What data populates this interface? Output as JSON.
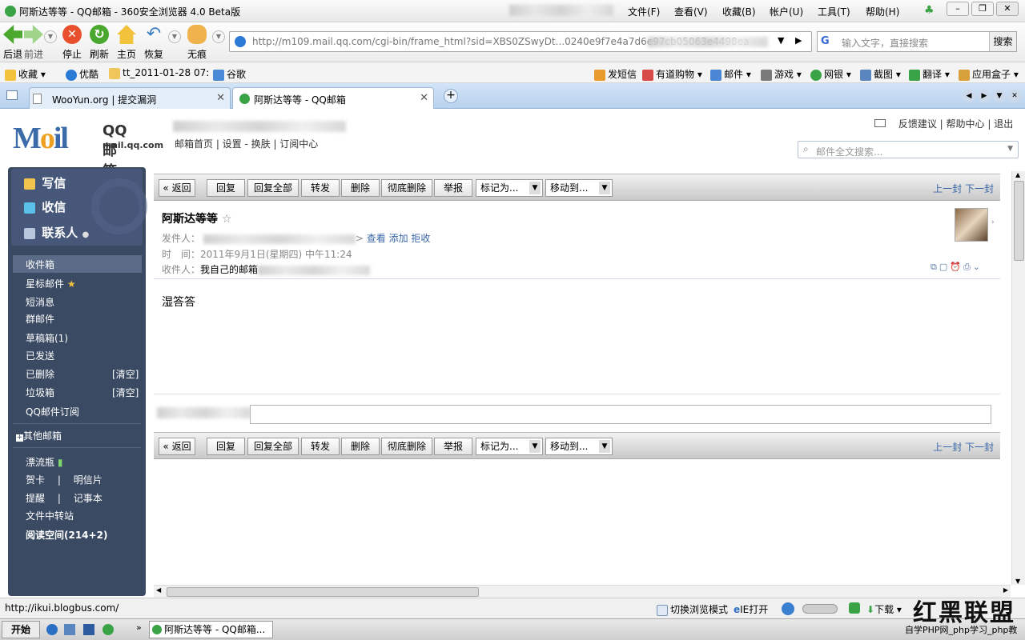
{
  "window": {
    "title": "阿斯达等等 - QQ邮箱 - 360安全浏览器 4.0 Beta版",
    "menu": [
      "文件(F)",
      "查看(V)",
      "收藏(B)",
      "帐户(U)",
      "工具(T)",
      "帮助(H)"
    ]
  },
  "nav": {
    "back": "后退",
    "forward": "前进",
    "stop": "停止",
    "refresh": "刷新",
    "home": "主页",
    "restore": "恢复",
    "notrace": "无痕",
    "url": "http://m109.mail.qq.com/cgi-bin/frame_html?sid=XBS0ZSwyDt...0240e9f7e4a7d6e97cb05063e4498ea",
    "search_placeholder": "输入文字，直接搜索",
    "search_button": "搜索"
  },
  "favorites": {
    "left": [
      "收藏",
      "优酷",
      "tt_2011-01-28 07:",
      "谷歌"
    ],
    "right": [
      "发短信",
      "有道购物",
      "邮件",
      "游戏",
      "网银",
      "截图",
      "翻译",
      "应用盒子"
    ]
  },
  "tabs": [
    {
      "label": "WooYun.org | 提交漏洞"
    },
    {
      "label": "阿斯达等等 - QQ邮箱"
    }
  ],
  "mail": {
    "logo_text": "QQ邮箱",
    "logo_domain": "mail.qq.com",
    "top_links": "邮箱首页 | 设置 - 换肤 | 订阅中心",
    "right_links": [
      "反馈建议",
      "帮助中心",
      "退出"
    ],
    "search_placeholder": "邮件全文搜索...",
    "sidebar": {
      "write": "写信",
      "receive": "收信",
      "contacts": "联系人",
      "folders": [
        "收件箱",
        "星标邮件",
        "短消息",
        "群邮件",
        "草稿箱(1)",
        "已发送",
        "已删除",
        "垃圾箱",
        "QQ邮件订阅"
      ],
      "clear_label": "[清空]",
      "other_mailboxes": "其他邮箱",
      "extras": [
        "漂流瓶",
        "贺卡",
        "明信片",
        "提醒",
        "记事本",
        "文件中转站"
      ],
      "reading_space": "阅读空间(214+2)"
    },
    "toolbar": {
      "back": "« 返回",
      "reply": "回复",
      "reply_all": "回复全部",
      "forward": "转发",
      "delete": "删除",
      "delete_permanent": "彻底删除",
      "report": "举报",
      "mark_as": "标记为...",
      "move_to": "移动到...",
      "prev": "上一封",
      "next": "下一封"
    },
    "message": {
      "subject": "阿斯达等等",
      "from_label": "发件人：",
      "from_links": [
        "查看",
        "添加",
        "拒收"
      ],
      "time_label": "时　间：",
      "time": "2011年9月1日(星期四) 中午11:24",
      "to_label": "收件人：",
      "to": "我自己的邮箱",
      "body": "湿答答"
    }
  },
  "status": {
    "url": "http://ikui.blogbus.com/",
    "switch_mode": "切换浏览模式",
    "ie_open": "IE打开",
    "download": "下载"
  },
  "taskbar": {
    "start": "开始",
    "item": "阿斯达等等 - QQ邮箱..."
  },
  "watermark": {
    "logo": "红黑联盟",
    "text": "自学PHP网_php学习_php教"
  },
  "colors": {
    "sidebar": "#3a4a63",
    "link": "#3a67a7",
    "tabbar": "#c6dbf2"
  }
}
